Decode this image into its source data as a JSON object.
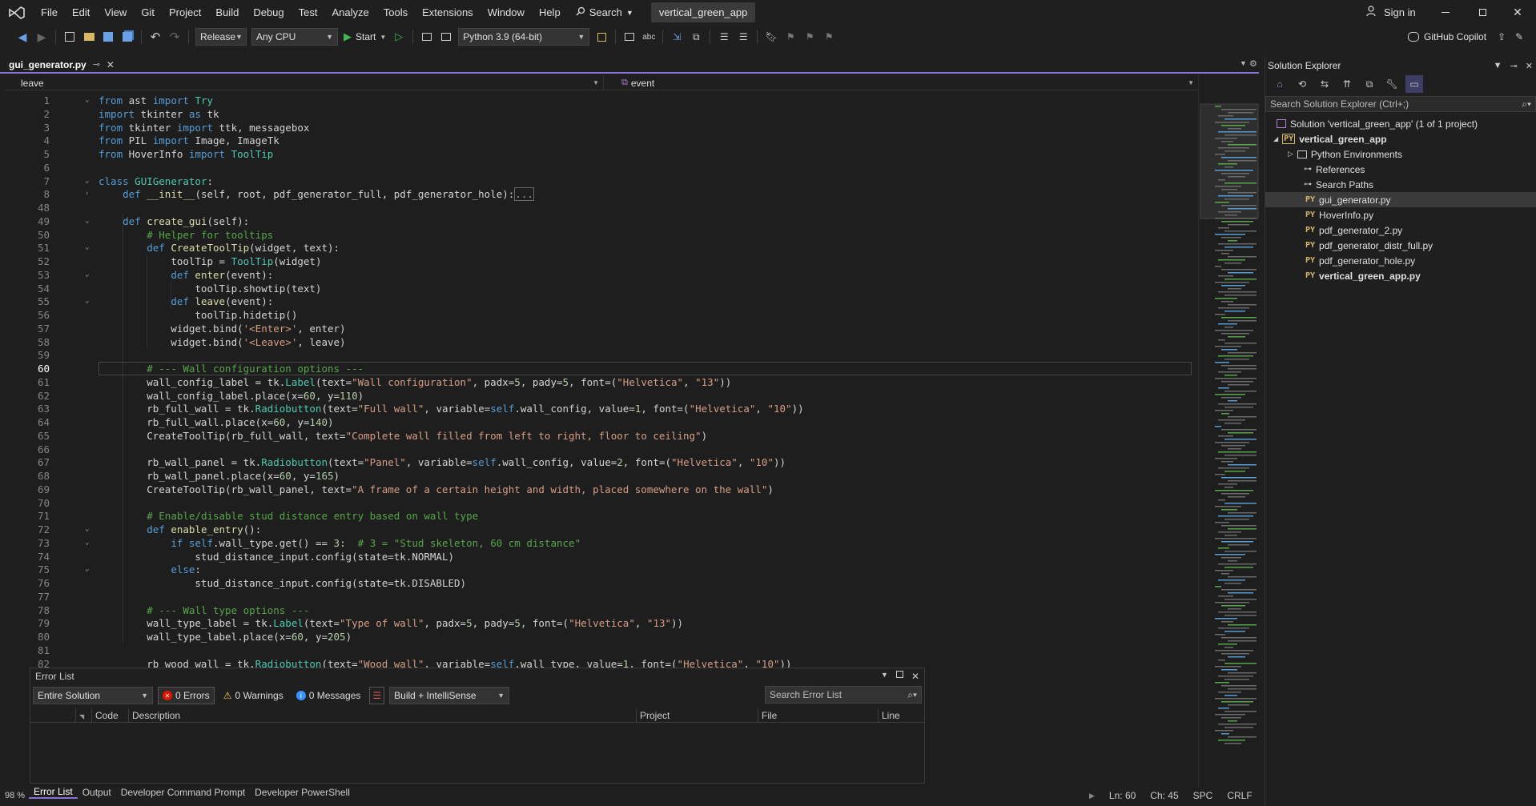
{
  "menubar": {
    "items": [
      "File",
      "Edit",
      "View",
      "Git",
      "Project",
      "Build",
      "Debug",
      "Test",
      "Analyze",
      "Tools",
      "Extensions",
      "Window",
      "Help"
    ],
    "search_label": "Search",
    "solution_title": "vertical_green_app",
    "signin_label": "Sign in"
  },
  "toolbar": {
    "configuration": "Release",
    "platform": "Any CPU",
    "start_label": "Start",
    "environment": "Python 3.9 (64-bit)",
    "copilot_label": "GitHub Copilot"
  },
  "editor": {
    "tab_label": "gui_generator.py",
    "nav_left": "leave",
    "nav_right": "event",
    "lines": [
      {
        "n": "1",
        "fold": "v",
        "html": "<span class='kw'>from</span> ast <span class='kw'>import</span> <span class='cls'>Try</span>"
      },
      {
        "n": "2",
        "html": "<span class='kw'>import</span> tkinter <span class='kw'>as</span> tk"
      },
      {
        "n": "3",
        "html": "<span class='kw'>from</span> tkinter <span class='kw'>import</span> ttk, messagebox"
      },
      {
        "n": "4",
        "html": "<span class='kw'>from</span> PIL <span class='kw'>import</span> Image, ImageTk"
      },
      {
        "n": "5",
        "html": "<span class='kw'>from</span> HoverInfo <span class='kw'>import</span> <span class='cls'>ToolTip</span>"
      },
      {
        "n": "6",
        "html": ""
      },
      {
        "n": "7",
        "fold": "v",
        "html": "<span class='kw'>class</span> <span class='cls'>GUIGenerator</span>:"
      },
      {
        "n": "8",
        "fold": ">",
        "html": "    <span class='kw'>def</span> <span class='fn'>__init__</span>(self, root, pdf_generator_full, pdf_generator_hole):<span style='border:1px solid #666;color:#999'>...</span>"
      },
      {
        "n": "48",
        "html": ""
      },
      {
        "n": "49",
        "fold": "v",
        "html": "    <span class='kw'>def</span> <span class='fn'>create_gui</span>(self):"
      },
      {
        "n": "50",
        "html": "        <span class='cmt'># Helper for tooltips</span>"
      },
      {
        "n": "51",
        "fold": "v",
        "html": "        <span class='kw'>def</span> <span class='fn'>CreateToolTip</span>(widget, text):"
      },
      {
        "n": "52",
        "html": "            toolTip = <span class='cls'>ToolTip</span>(widget)"
      },
      {
        "n": "53",
        "fold": "v",
        "html": "            <span class='kw'>def</span> <span class='fn'>enter</span>(event):"
      },
      {
        "n": "54",
        "html": "                toolTip.showtip(text)"
      },
      {
        "n": "55",
        "fold": "v",
        "html": "            <span class='kw'>def</span> <span class='fn'>leave</span>(event):"
      },
      {
        "n": "56",
        "html": "                toolTip.hidetip()"
      },
      {
        "n": "57",
        "html": "            widget.bind(<span class='str'>'&lt;Enter&gt;'</span>, enter)"
      },
      {
        "n": "58",
        "html": "            widget.bind(<span class='str'>'&lt;Leave&gt;'</span>, leave)"
      },
      {
        "n": "59",
        "html": ""
      },
      {
        "n": "60",
        "cur": true,
        "html": "        <span class='cmt'># --- Wall configuration options ---</span>"
      },
      {
        "n": "61",
        "html": "        wall_config_label = tk.<span class='cls'>Label</span>(text=<span class='str'>\"Wall configuration\"</span>, padx=<span class='num'>5</span>, pady=<span class='num'>5</span>, font=(<span class='str'>\"Helvetica\"</span>, <span class='str'>\"13\"</span>))"
      },
      {
        "n": "62",
        "html": "        wall_config_label.place(x=<span class='num'>60</span>, y=<span class='num'>110</span>)"
      },
      {
        "n": "63",
        "html": "        rb_full_wall = tk.<span class='cls'>Radiobutton</span>(text=<span class='str'>\"Full wall\"</span>, variable=<span class='kw'>self</span>.wall_config, value=<span class='num'>1</span>, font=(<span class='str'>\"Helvetica\"</span>, <span class='str'>\"10\"</span>))"
      },
      {
        "n": "64",
        "html": "        rb_full_wall.place(x=<span class='num'>60</span>, y=<span class='num'>140</span>)"
      },
      {
        "n": "65",
        "html": "        CreateToolTip(rb_full_wall, text=<span class='str'>\"Complete wall filled from left to right, floor to ceiling\"</span>)"
      },
      {
        "n": "66",
        "html": ""
      },
      {
        "n": "67",
        "html": "        rb_wall_panel = tk.<span class='cls'>Radiobutton</span>(text=<span class='str'>\"Panel\"</span>, variable=<span class='kw'>self</span>.wall_config, value=<span class='num'>2</span>, font=(<span class='str'>\"Helvetica\"</span>, <span class='str'>\"10\"</span>))"
      },
      {
        "n": "68",
        "html": "        rb_wall_panel.place(x=<span class='num'>60</span>, y=<span class='num'>165</span>)"
      },
      {
        "n": "69",
        "html": "        CreateToolTip(rb_wall_panel, text=<span class='str'>\"A frame of a certain height and width, placed somewhere on the wall\"</span>)"
      },
      {
        "n": "70",
        "html": ""
      },
      {
        "n": "71",
        "html": "        <span class='cmt'># Enable/disable stud distance entry based on wall type</span>"
      },
      {
        "n": "72",
        "fold": "v",
        "html": "        <span class='kw'>def</span> <span class='fn'>enable_entry</span>():"
      },
      {
        "n": "73",
        "fold": "v",
        "html": "            <span class='kw'>if</span> <span class='kw'>self</span>.wall_type.get() == <span class='num'>3</span>:  <span class='cmt'># 3 = \"Stud skeleton, 60 cm distance\"</span>"
      },
      {
        "n": "74",
        "html": "                stud_distance_input.config(state=tk.NORMAL)"
      },
      {
        "n": "75",
        "fold": "v",
        "html": "            <span class='kw'>else</span>:"
      },
      {
        "n": "76",
        "html": "                stud_distance_input.config(state=tk.DISABLED)"
      },
      {
        "n": "77",
        "html": ""
      },
      {
        "n": "78",
        "html": "        <span class='cmt'># --- Wall type options ---</span>"
      },
      {
        "n": "79",
        "html": "        wall_type_label = tk.<span class='cls'>Label</span>(text=<span class='str'>\"Type of wall\"</span>, padx=<span class='num'>5</span>, pady=<span class='num'>5</span>, font=(<span class='str'>\"Helvetica\"</span>, <span class='str'>\"13\"</span>))"
      },
      {
        "n": "80",
        "html": "        wall_type_label.place(x=<span class='num'>60</span>, y=<span class='num'>205</span>)"
      },
      {
        "n": "81",
        "html": ""
      },
      {
        "n": "82",
        "html": "        rb_wood_wall = tk.<span class='cls'>Radiobutton</span>(text=<span class='str'>\"Wood wall\"</span>, variable=<span class='kw'>self</span>.wall_type, value=<span class='num'>1</span>, font=(<span class='str'>\"Helvetica\"</span>, <span class='str'>\"10\"</span>))"
      }
    ]
  },
  "errorlist": {
    "title": "Error List",
    "scope": "Entire Solution",
    "errors": "0 Errors",
    "warnings": "0 Warnings",
    "messages": "0 Messages",
    "build_filter": "Build + IntelliSense",
    "search_placeholder": "Search Error List",
    "columns": [
      "Code",
      "Description",
      "Project",
      "File",
      "Line"
    ]
  },
  "bottom_tabs": [
    "Error List",
    "Output",
    "Developer Command Prompt",
    "Developer PowerShell"
  ],
  "status": {
    "zoom": "98 %",
    "ln": "Ln: 60",
    "ch": "Ch: 45",
    "spc": "SPC",
    "crlf": "CRLF"
  },
  "solution_explorer": {
    "title": "Solution Explorer",
    "search_placeholder": "Search Solution Explorer (Ctrl+;)",
    "solution": "Solution 'vertical_green_app' (1 of 1 project)",
    "project": "vertical_green_app",
    "python_env": "Python Environments",
    "references": "References",
    "search_paths": "Search Paths",
    "files": [
      "gui_generator.py",
      "HoverInfo.py",
      "pdf_generator_2.py",
      "pdf_generator_distr_full.py",
      "pdf_generator_hole.py",
      "vertical_green_app.py"
    ]
  },
  "colors": {
    "accent": "#8a6fd6",
    "background": "#1e1e1e",
    "keyword": "#569cd6",
    "string": "#d69d85",
    "comment": "#57a64a",
    "class": "#4ec9b0"
  }
}
